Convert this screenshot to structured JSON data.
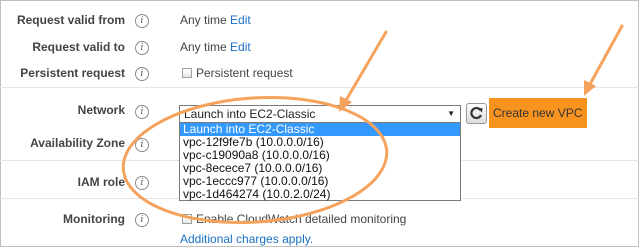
{
  "rows": {
    "request_valid_from": {
      "label": "Request valid from",
      "value": "Any time",
      "link": "Edit"
    },
    "request_valid_to": {
      "label": "Request valid to",
      "value": "Any time",
      "link": "Edit"
    },
    "persistent_request": {
      "label": "Persistent request",
      "checkbox_label": "Persistent request"
    },
    "network": {
      "label": "Network",
      "selected": "Launch into EC2-Classic",
      "options": [
        "Launch into EC2-Classic",
        "vpc-12f9fe7b (10.0.0.0/16)",
        "vpc-c19090a8 (10.0.0.0/16)",
        "vpc-8ecece7 (10.0.0.0/16)",
        "vpc-1eccc977 (10.0.0.0/16)",
        "vpc-1d464274 (10.0.2.0/24)"
      ],
      "create_button": "Create new VPC"
    },
    "availability_zone": {
      "label": "Availability Zone"
    },
    "iam_role": {
      "label": "IAM role"
    },
    "monitoring": {
      "label": "Monitoring",
      "checkbox_label": "Enable CloudWatch detailed monitoring",
      "note": "Additional charges apply."
    }
  },
  "info_icon": "i",
  "icons": {
    "info": "info-icon",
    "refresh": "refresh-icon",
    "dropdown": "chevron-down-icon",
    "checkbox": "checkbox-icon"
  },
  "colors": {
    "annotation": "#f5a25d",
    "button": "#f7931e",
    "link": "#1a6fc4",
    "highlight": "#3399ff"
  }
}
